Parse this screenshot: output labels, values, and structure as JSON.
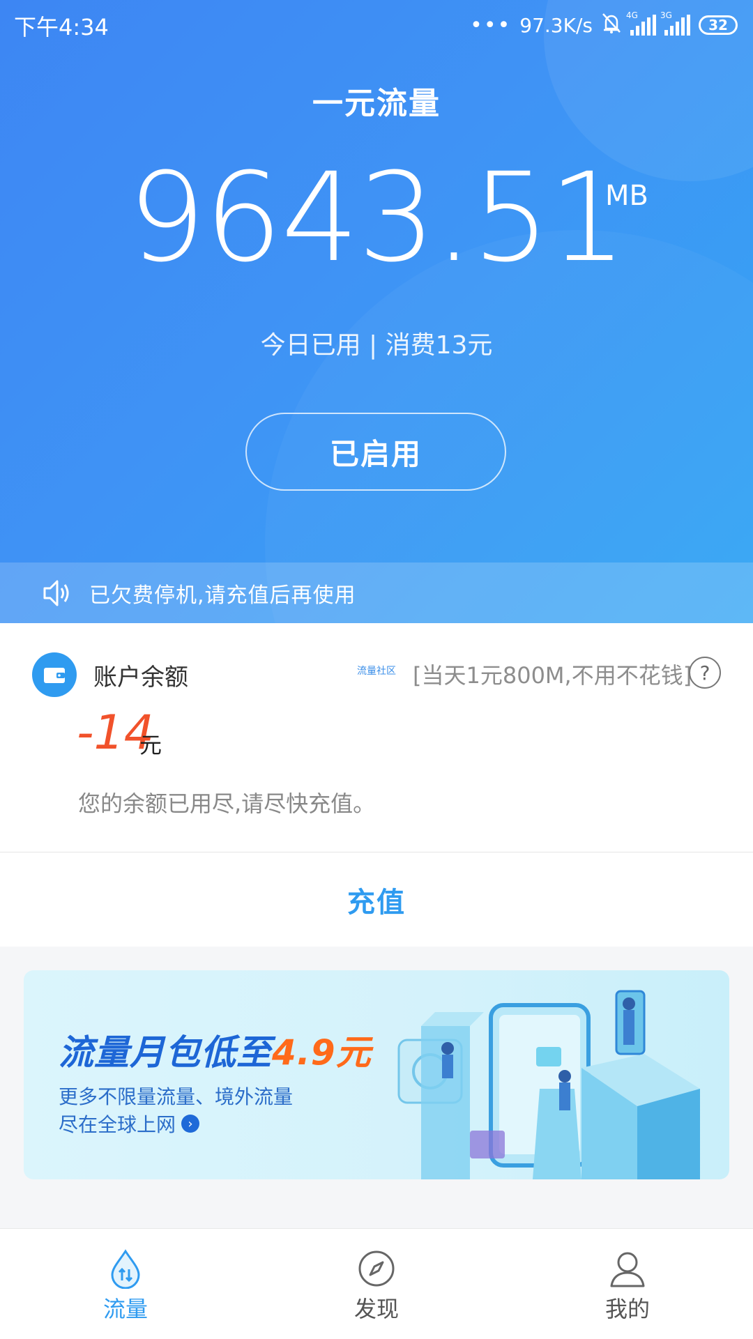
{
  "status_bar": {
    "time": "下午4:34",
    "network_speed": "97.3K/s",
    "signal1_label": "4G",
    "signal2_label": "3G",
    "battery": "32"
  },
  "header": {
    "title": "一元流量",
    "data_amount": "9643.51",
    "data_unit": "MB",
    "usage_text": "今日已用 | 消费13元",
    "status_button": "已启用"
  },
  "notice": {
    "text": "已欠费停机,请充值后再使用",
    "icon": "speaker-icon"
  },
  "account": {
    "label": "账户余额",
    "community_tag": "流量社区",
    "promo": "[当天1元800M,不用不花钱]",
    "help": "?",
    "balance": "-14",
    "balance_unit": "元",
    "tip": "您的余额已用尽,请尽快充值。",
    "recharge_label": "充值"
  },
  "banner": {
    "title_prefix": "流量月包低至",
    "title_highlight": "4.9元",
    "subtitle_line1": "更多不限量流量、境外流量",
    "subtitle_line2": "尽在全球上网"
  },
  "bottom_nav": {
    "items": [
      {
        "label": "流量",
        "icon": "data-drop-icon",
        "active": true
      },
      {
        "label": "发现",
        "icon": "compass-icon",
        "active": false
      },
      {
        "label": "我的",
        "icon": "person-icon",
        "active": false
      }
    ]
  },
  "colors": {
    "primary_blue": "#2f9bf0",
    "hero_gradient_start": "#3d86f3",
    "hero_gradient_end": "#34a6f4",
    "negative_red": "#f1522b",
    "highlight_orange": "#ff6a1a"
  }
}
